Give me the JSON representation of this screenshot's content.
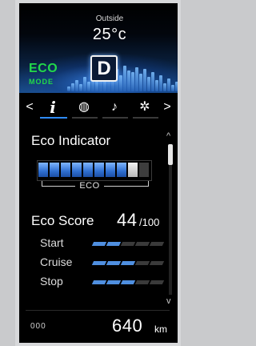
{
  "header": {
    "outside_label": "Outside",
    "temperature": "25°c",
    "eco_label": "ECO",
    "mode_label": "MODE",
    "gear": "D"
  },
  "tabs": [
    {
      "name": "prev",
      "glyph": "<"
    },
    {
      "name": "info",
      "glyph": "i",
      "active": true
    },
    {
      "name": "gauge",
      "glyph": "◍"
    },
    {
      "name": "audio",
      "glyph": "♪"
    },
    {
      "name": "settings",
      "glyph": "✲"
    },
    {
      "name": "next",
      "glyph": ">"
    }
  ],
  "eco_indicator": {
    "title": "Eco Indicator",
    "zone_label": "ECO",
    "segments_lit": 8,
    "segments_total": 10
  },
  "eco_score": {
    "title": "Eco Score",
    "value": "44",
    "max": "/100",
    "rows": [
      {
        "label": "Start",
        "level": 2,
        "of": 5
      },
      {
        "label": "Cruise",
        "level": 3,
        "of": 5
      },
      {
        "label": "Stop",
        "level": 3,
        "of": 5
      }
    ]
  },
  "footer": {
    "trip": "000",
    "range": "640",
    "unit": "km"
  },
  "colors": {
    "accent_blue": "#2e8bff",
    "eco_green": "#22d84a",
    "bar_blue": "#4f8fe0"
  }
}
